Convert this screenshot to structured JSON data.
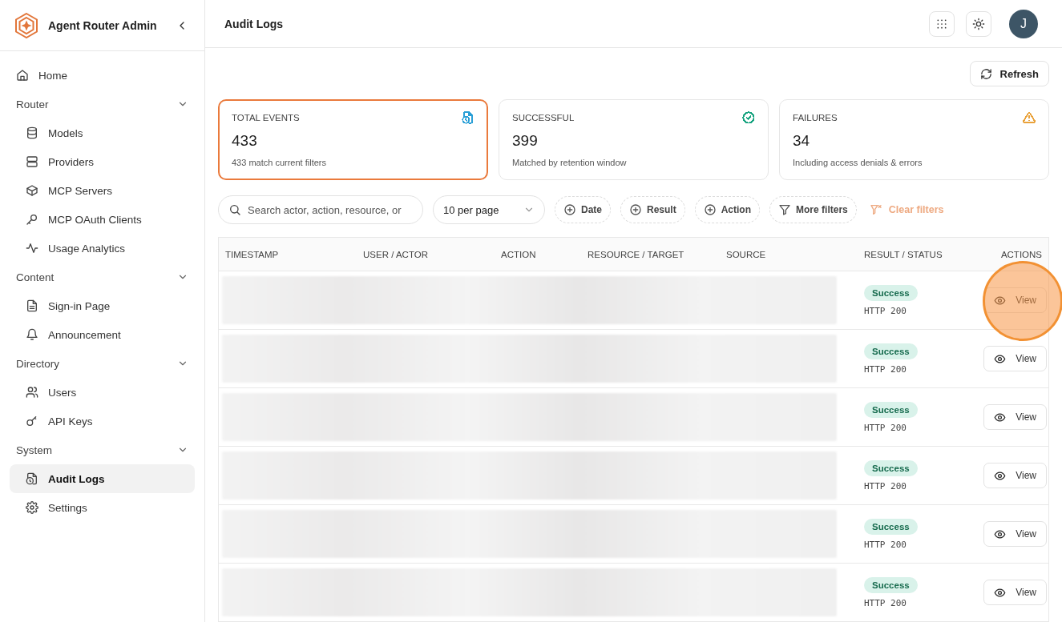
{
  "app": {
    "title": "Agent Router Admin"
  },
  "sidebar": {
    "items": [
      {
        "kind": "link",
        "label": "Home",
        "selected": false
      },
      {
        "kind": "section",
        "label": "Router",
        "expanded": true,
        "children": [
          {
            "label": "Models",
            "selected": false
          },
          {
            "label": "Providers",
            "selected": false
          },
          {
            "label": "MCP Servers",
            "selected": false
          },
          {
            "label": "MCP OAuth Clients",
            "selected": false
          },
          {
            "label": "Usage Analytics",
            "selected": false
          }
        ]
      },
      {
        "kind": "section",
        "label": "Content",
        "expanded": true,
        "children": [
          {
            "label": "Sign-in Page",
            "selected": false
          },
          {
            "label": "Announcement",
            "selected": false
          }
        ]
      },
      {
        "kind": "section",
        "label": "Directory",
        "expanded": true,
        "children": [
          {
            "label": "Users",
            "selected": false
          },
          {
            "label": "API Keys",
            "selected": false
          }
        ]
      },
      {
        "kind": "section",
        "label": "System",
        "expanded": true,
        "children": [
          {
            "label": "Audit Logs",
            "selected": true
          },
          {
            "label": "Settings",
            "selected": false
          }
        ]
      }
    ]
  },
  "header": {
    "title": "Audit Logs",
    "avatar": "J"
  },
  "refresh_button": "Refresh",
  "stats": [
    {
      "label": "TOTAL EVENTS",
      "value": "433",
      "note": "433 match current filters",
      "color": "#2a9fd6",
      "selected": true
    },
    {
      "label": "SUCCESSFUL",
      "value": "399",
      "note": "Matched by retention window",
      "color": "#16a37f",
      "selected": false
    },
    {
      "label": "FAILURES",
      "value": "34",
      "note": "Including access denials & errors",
      "color": "#e9a23b",
      "selected": false
    }
  ],
  "filters": {
    "search_placeholder": "Search actor, action, resource, or",
    "page_size": "10 per page",
    "chips": [
      {
        "kind": "add",
        "label": "Date"
      },
      {
        "kind": "add",
        "label": "Result"
      },
      {
        "kind": "add",
        "label": "Action"
      },
      {
        "kind": "filter",
        "label": "More filters"
      }
    ],
    "clear": "Clear filters"
  },
  "table": {
    "columns": [
      "TIMESTAMP",
      "USER / ACTOR",
      "ACTION",
      "RESOURCE / TARGET",
      "SOURCE",
      "RESULT / STATUS",
      "ACTIONS"
    ],
    "rows": [
      {
        "result": "Success",
        "status": "HTTP 200",
        "action": "View"
      },
      {
        "result": "Success",
        "status": "HTTP 200",
        "action": "View"
      },
      {
        "result": "Success",
        "status": "HTTP 200",
        "action": "View"
      },
      {
        "result": "Success",
        "status": "HTTP 200",
        "action": "View"
      },
      {
        "result": "Success",
        "status": "HTTP 200",
        "action": "View"
      },
      {
        "result": "Success",
        "status": "HTTP 200",
        "action": "View"
      }
    ]
  },
  "click_marker": {
    "visible": true
  }
}
